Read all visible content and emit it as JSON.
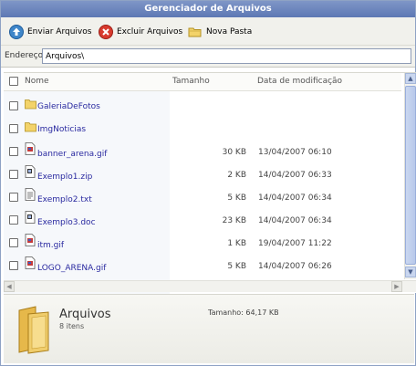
{
  "window": {
    "title": "Gerenciador de Arquivos"
  },
  "toolbar": {
    "upload_label": "Enviar Arquivos",
    "delete_label": "Excluir Arquivos",
    "newfolder_label": "Nova Pasta"
  },
  "address": {
    "label": "Endereço:",
    "value": "Arquivos\\"
  },
  "columns": {
    "name": "Nome",
    "size": "Tamanho",
    "modified": "Data de modificação"
  },
  "files": [
    {
      "name": "GaleriaDeFotos",
      "size": "",
      "date": "",
      "icon": "folder-icon"
    },
    {
      "name": "ImgNoticias",
      "size": "",
      "date": "",
      "icon": "folder-icon"
    },
    {
      "name": "banner_arena.gif",
      "size": "30 KB",
      "date": "13/04/2007 06:10",
      "icon": "image-file-icon"
    },
    {
      "name": "Exemplo1.zip",
      "size": "2 KB",
      "date": "14/04/2007 06:33",
      "icon": "generic-file-icon"
    },
    {
      "name": "Exemplo2.txt",
      "size": "5 KB",
      "date": "14/04/2007 06:34",
      "icon": "text-file-icon"
    },
    {
      "name": "Exemplo3.doc",
      "size": "23 KB",
      "date": "14/04/2007 06:34",
      "icon": "generic-file-icon"
    },
    {
      "name": "itm.gif",
      "size": "1 KB",
      "date": "19/04/2007 11:22",
      "icon": "image-file-icon"
    },
    {
      "name": "LOGO_ARENA.gif",
      "size": "5 KB",
      "date": "14/04/2007 06:26",
      "icon": "image-file-icon"
    }
  ],
  "details": {
    "title": "Arquivos",
    "count": "8 itens",
    "size": "Tamanho: 64,17 KB"
  },
  "colors": {
    "title_bar": "#6b84bd",
    "link_text": "#2a2aa0",
    "toolbar_bg": "#f1f1ec"
  }
}
